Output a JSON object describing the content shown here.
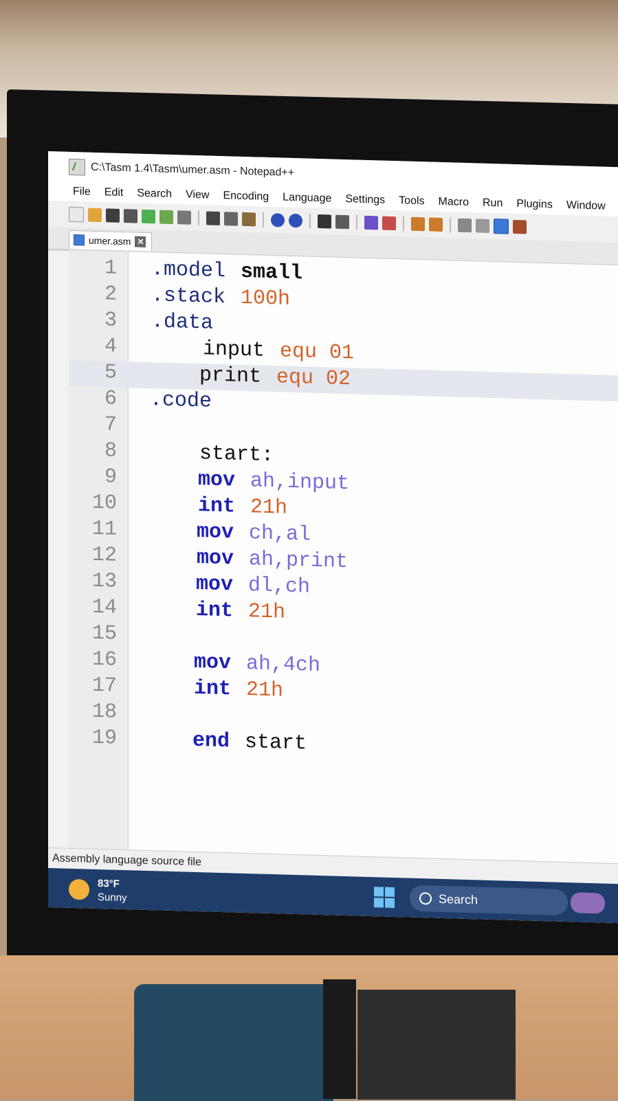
{
  "window": {
    "title": "C:\\Tasm 1.4\\Tasm\\umer.asm - Notepad++"
  },
  "menu": [
    "File",
    "Edit",
    "Search",
    "View",
    "Encoding",
    "Language",
    "Settings",
    "Tools",
    "Macro",
    "Run",
    "Plugins",
    "Window"
  ],
  "tab": {
    "label": "umer.asm"
  },
  "code": [
    {
      "n": "1",
      "text": ".model",
      "arg": "small"
    },
    {
      "n": "2",
      "text": ".stack",
      "arg": "100h"
    },
    {
      "n": "3",
      "text": ".data",
      "arg": ""
    },
    {
      "n": "4",
      "text": "input",
      "arg": "equ 01"
    },
    {
      "n": "5",
      "text": "print",
      "arg": "equ 02"
    },
    {
      "n": "6",
      "text": ".code",
      "arg": ""
    },
    {
      "n": "7",
      "text": "",
      "arg": ""
    },
    {
      "n": "8",
      "text": "start:",
      "arg": ""
    },
    {
      "n": "9",
      "text": "mov",
      "arg": "ah,input"
    },
    {
      "n": "10",
      "text": "int",
      "arg": "21h"
    },
    {
      "n": "11",
      "text": "mov",
      "arg": "ch,al"
    },
    {
      "n": "12",
      "text": "mov",
      "arg": "ah,print"
    },
    {
      "n": "13",
      "text": "mov",
      "arg": "dl,ch"
    },
    {
      "n": "14",
      "text": "int",
      "arg": "21h"
    },
    {
      "n": "15",
      "text": "",
      "arg": ""
    },
    {
      "n": "16",
      "text": "mov",
      "arg": "ah,4ch"
    },
    {
      "n": "17",
      "text": "int",
      "arg": "21h"
    },
    {
      "n": "18",
      "text": "",
      "arg": ""
    },
    {
      "n": "19",
      "text": "end",
      "arg": "start"
    }
  ],
  "status": {
    "file_type": "Assembly language source file"
  },
  "taskbar": {
    "temperature": "83°F",
    "condition": "Sunny",
    "search_label": "Search"
  },
  "colors": {
    "keyword": "#1f1fb5",
    "number": "#d2622a",
    "taskbar": "#1e3d6a"
  }
}
